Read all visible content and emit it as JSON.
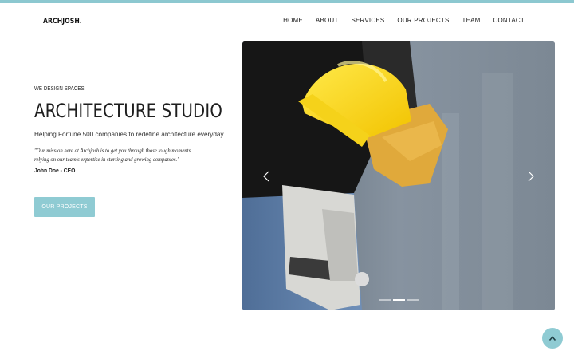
{
  "brand": {
    "name": "ARCHJOSH.",
    "accent": "#8cc8d0"
  },
  "nav": {
    "items": [
      {
        "label": "HOME"
      },
      {
        "label": "ABOUT"
      },
      {
        "label": "SERVICES"
      },
      {
        "label": "OUR PROJECTS"
      },
      {
        "label": "TEAM"
      },
      {
        "label": "CONTACT"
      }
    ]
  },
  "hero": {
    "eyebrow": "WE DESIGN SPACES",
    "title": "ARCHITECTURE STUDIO",
    "subtitle": "Helping Fortune 500 companies to redefine architecture everyday",
    "quote": "\"Our mission here at Archjosh is to get you through those tough moments relying on our team's expertise in starting and growing companies.\"",
    "author": "John Doe - CEO",
    "button_label": "OUR PROJECTS",
    "button_color": "#8fcbd3"
  },
  "carousel": {
    "prev_icon": "chevron-left-icon",
    "next_icon": "chevron-right-icon",
    "slide_count": 3,
    "active_index": 1
  },
  "scroll_top": {
    "icon": "chevron-up-icon",
    "color": "#8fcbd3"
  }
}
